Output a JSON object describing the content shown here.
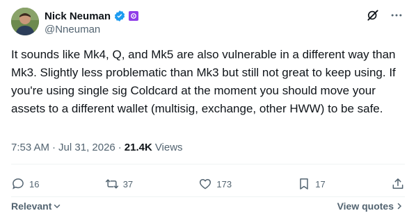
{
  "author": {
    "name": "Nick Neuman",
    "handle": "@Nneuman"
  },
  "icons": {
    "verified": "verified-badge-icon",
    "affiliate": "affiliate-badge-icon",
    "grok": "grok-icon",
    "more": "more-icon"
  },
  "tweet": {
    "text": "It sounds like Mk4, Q, and Mk5 are also vulnerable in a different way than Mk3. Slightly less problematic than Mk3 but still not great to keep using. If you're using single sig Coldcard at the moment you should move your assets to a different wallet (multisig, exchange, other HWW) to be safe."
  },
  "meta": {
    "time": "7:53 AM",
    "separator": "·",
    "date": "Jul 31, 2026",
    "views_count": "21.4K",
    "views_label": "Views"
  },
  "actions": {
    "replies": "16",
    "reposts": "37",
    "likes": "173",
    "bookmarks": "17"
  },
  "footer": {
    "sort_label": "Relevant",
    "view_quotes_label": "View quotes"
  },
  "colors": {
    "verified_blue": "#1d9bf0",
    "affiliate_purple": "#8f3ee8",
    "muted": "#536471",
    "text": "#0f1419"
  }
}
